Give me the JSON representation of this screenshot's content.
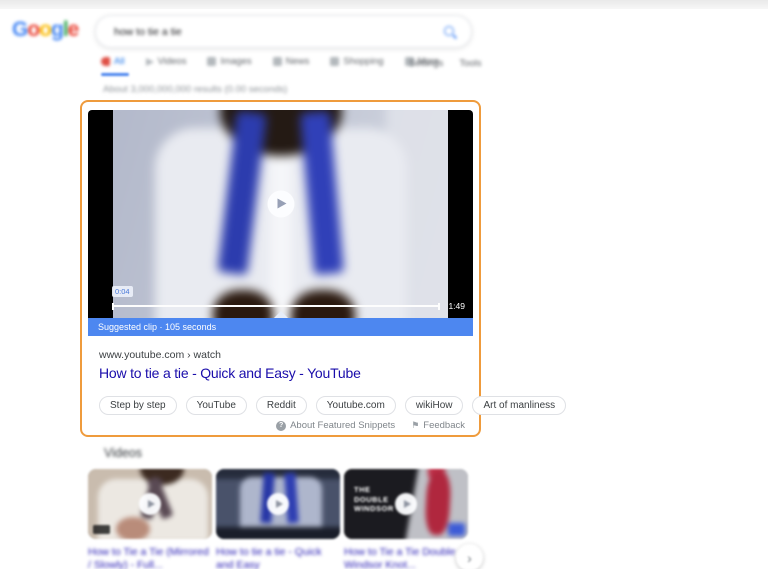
{
  "header": {
    "logo_letters": [
      {
        "char": "G"
      },
      {
        "char": "o"
      },
      {
        "char": "o"
      },
      {
        "char": "g"
      },
      {
        "char": "l"
      },
      {
        "char": "e"
      }
    ],
    "search": {
      "value": "how to tie a tie"
    }
  },
  "tabs": {
    "items": [
      {
        "label": "All",
        "active": true
      },
      {
        "label": "Videos",
        "active": false
      },
      {
        "label": "Images",
        "active": false
      },
      {
        "label": "News",
        "active": false
      },
      {
        "label": "Shopping",
        "active": false
      },
      {
        "label": "More",
        "active": false
      }
    ],
    "settings_label": "Settings",
    "tools_label": "Tools"
  },
  "stats": {
    "text": "About 3,000,000,000 results (0.00 seconds)"
  },
  "featured_snippet": {
    "video": {
      "current_time": "0:04",
      "duration": "1:49",
      "suggested_clip": "Suggested clip · 105 seconds"
    },
    "source_url": "www.youtube.com › watch",
    "title": "How to tie a tie - Quick and Easy - YouTube",
    "chips": [
      "Step by step",
      "YouTube",
      "Reddit",
      "Youtube.com",
      "wikiHow",
      "Art of manliness"
    ],
    "about_label": "About Featured Snippets",
    "feedback_label": "Feedback"
  },
  "videos_section": {
    "heading": "Videos",
    "items": [
      {
        "title": "How to Tie a Tie (Mirrored / Slowly) - Full..."
      },
      {
        "title": "How to tie a tie - Quick and Easy"
      },
      {
        "title": "How to Tie a Tie Double Windsor Knot...",
        "overlay_text": "THE DOUBLE WINDSOR"
      }
    ]
  },
  "icons": {
    "help": "?",
    "feedback_flag": "⚑",
    "chevron_right": "›"
  },
  "colors": {
    "highlight_border_orange": "#ef9b3c",
    "suggested_clip_bar_blue": "#4d87f0",
    "link_blue": "#1a0dab",
    "active_tab_blue": "#1a73e8",
    "google_blue": "#4285F4",
    "google_red": "#EA4335",
    "google_yellow": "#FBBC05",
    "google_green": "#34A853"
  }
}
